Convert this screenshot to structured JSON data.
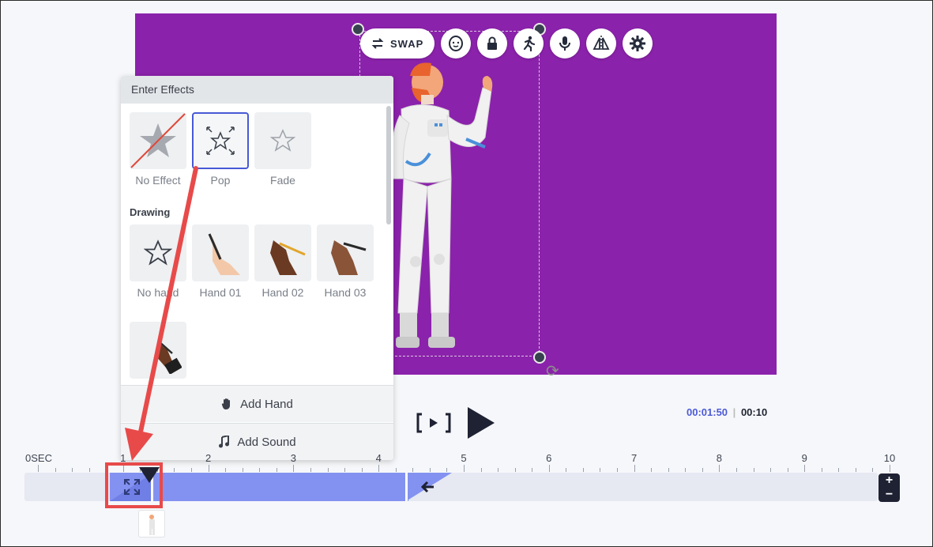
{
  "toolbar": {
    "swap_label": "SWAP",
    "icons": [
      "swap-icon",
      "face-icon",
      "lock-icon",
      "action-icon",
      "microphone-icon",
      "flip-icon",
      "gear-icon"
    ]
  },
  "effects_panel": {
    "title": "Enter Effects",
    "effects": [
      {
        "label": "No Effect",
        "icon": "no-effect-star-icon"
      },
      {
        "label": "Pop",
        "icon": "pop-star-icon",
        "selected": true
      },
      {
        "label": "Fade",
        "icon": "fade-star-icon"
      }
    ],
    "drawing_title": "Drawing",
    "hands": [
      {
        "label": "No hand"
      },
      {
        "label": "Hand 01"
      },
      {
        "label": "Hand 02"
      },
      {
        "label": "Hand 03"
      }
    ],
    "add_hand_label": "Add Hand",
    "add_sound_label": "Add Sound"
  },
  "playback": {
    "current_time": "00:01:50",
    "separator": "|",
    "total_time": "00:10"
  },
  "timeline": {
    "tick_labels": [
      "0SEC",
      "1",
      "2",
      "3",
      "4",
      "5",
      "6",
      "7",
      "8",
      "9",
      "10"
    ],
    "zoom_in": "+",
    "zoom_out": "−"
  },
  "colors": {
    "stage": "#8b22ab",
    "clip": "#8392f0",
    "accent": "#4b5ad8",
    "annotation": "#e84a4a"
  }
}
